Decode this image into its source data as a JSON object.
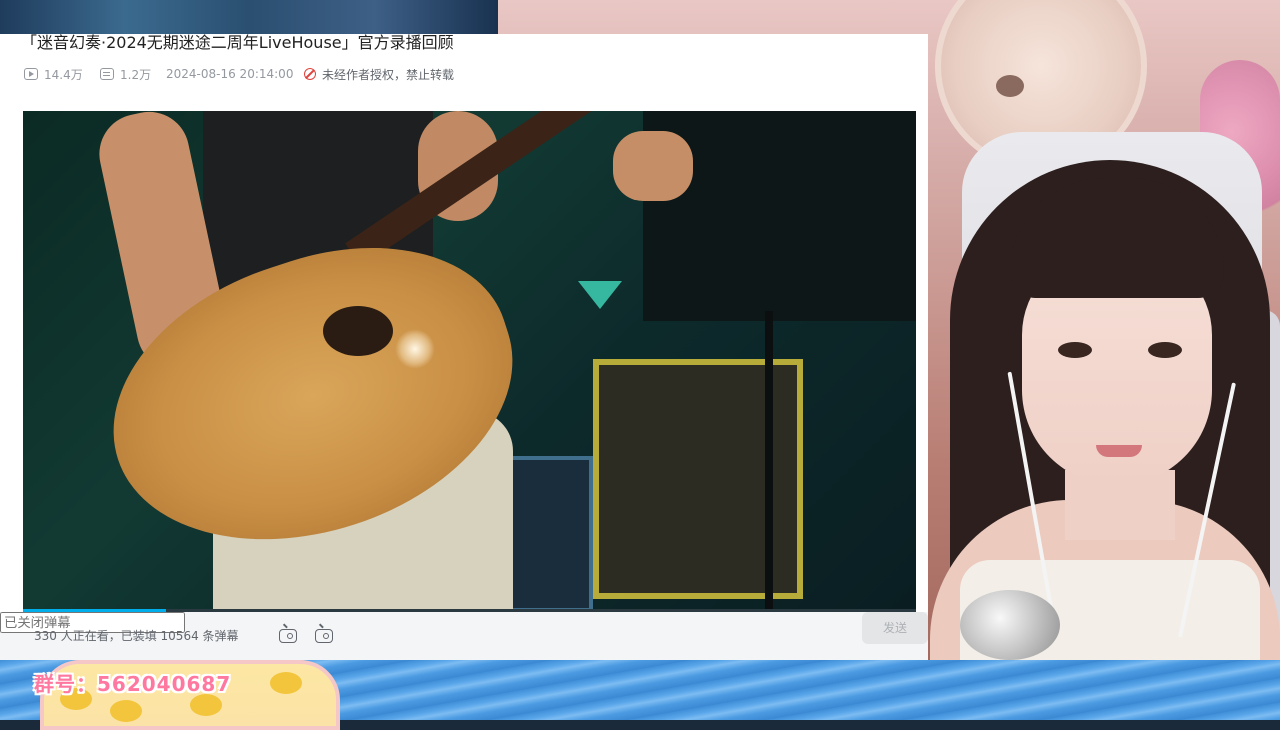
{
  "page": {
    "title": "「迷音幻奏·2024无期迷途二周年LiveHouse」官方录播回顾",
    "views": "14.4万",
    "danmaku_count": "1.2万",
    "publish_time": "2024-08-16 20:14:00",
    "copyright_notice": "未经作者授权，禁止转载"
  },
  "player": {
    "progress": 0.16,
    "accent_color": "#00aeec",
    "viewers_text": "330 人正在看，已装填 10564 条弹幕",
    "danmaku_input_placeholder": "已关闭弹幕",
    "send_label": "发送"
  },
  "overlay": {
    "group_number": "群号：562040687"
  },
  "icons": {
    "views": "play-count-icon",
    "danmaku": "danmaku-count-icon",
    "ban": "no-repost-icon",
    "danmaku_toggle": "danmaku-toggle-icon",
    "danmaku_settings": "danmaku-settings-icon"
  }
}
